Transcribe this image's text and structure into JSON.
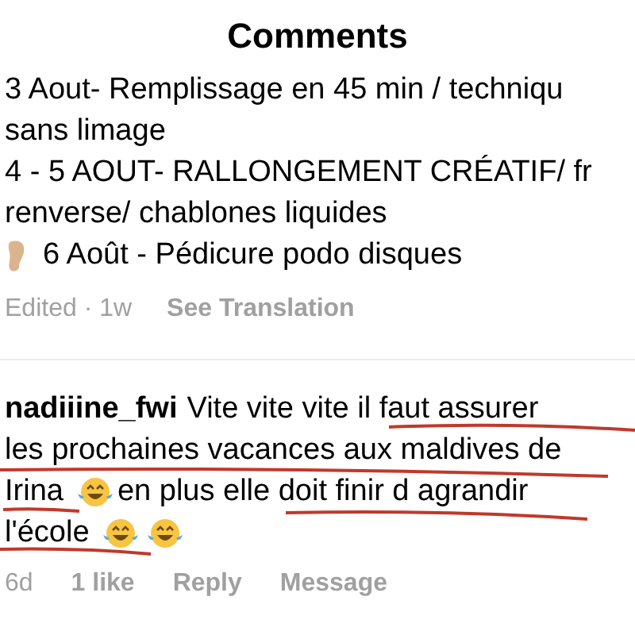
{
  "header": {
    "title": "Comments"
  },
  "caption": {
    "lines": [
      {
        "segments": [
          {
            "kind": "text",
            "text": "3 Aout- Remplissage en 45 min / techniqu"
          }
        ]
      },
      {
        "segments": [
          {
            "kind": "text",
            "text": "sans limage"
          }
        ]
      },
      {
        "segments": [
          {
            "kind": "text",
            "text": "4 - 5 AOUT- RALLONGEMENT CRÉATIF/ fr"
          }
        ]
      },
      {
        "segments": [
          {
            "kind": "text",
            "text": "renverse/ chablones liquides"
          }
        ]
      },
      {
        "segments": [
          {
            "kind": "foot"
          },
          {
            "kind": "text",
            "text": "6 Août - Pédicure podo disques"
          }
        ]
      }
    ],
    "meta": "Edited · 1w",
    "translate": "See Translation"
  },
  "comment": {
    "username": "nadiiine_fwi",
    "lines": [
      {
        "segments": [
          {
            "kind": "text",
            "text": "Vite vite vite il faut assurer"
          }
        ]
      },
      {
        "segments": [
          {
            "kind": "text",
            "text": "les prochaines vacances aux maldives de"
          }
        ]
      },
      {
        "segments": [
          {
            "kind": "text",
            "text": "Irina"
          },
          {
            "kind": "laugh"
          },
          {
            "kind": "text",
            "text": "en plus elle doit finir d agrandir"
          }
        ]
      },
      {
        "segments": [
          {
            "kind": "text",
            "text": "l'école"
          },
          {
            "kind": "laugh"
          },
          {
            "kind": "laugh"
          }
        ]
      }
    ],
    "age": "6d",
    "likes": "1 like",
    "actions": [
      "Reply",
      "Message"
    ]
  }
}
